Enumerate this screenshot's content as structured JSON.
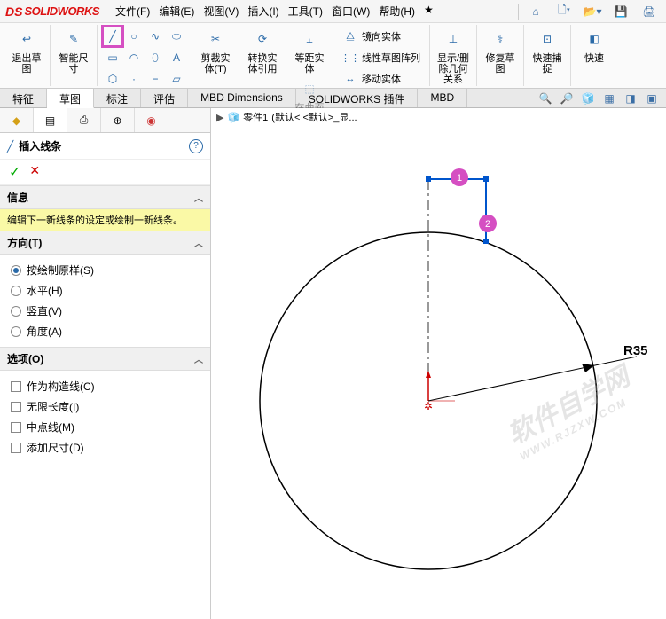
{
  "app": {
    "logo_ds": "DS",
    "logo_text": "SOLIDWORKS"
  },
  "menu": {
    "file": "文件(F)",
    "edit": "编辑(E)",
    "view": "视图(V)",
    "insert": "插入(I)",
    "tools": "工具(T)",
    "window": "窗口(W)",
    "help": "帮助(H)",
    "star": "★"
  },
  "ribbon": {
    "exit_sketch": "退出草图",
    "smart_dim": "智能尺寸",
    "trim": "剪裁实体(T)",
    "convert": "转换实体引用",
    "offset": "等距实体",
    "on_surface": "在曲面上偏移",
    "mirror": "镜向实体",
    "linear_pattern": "线性草图阵列",
    "move": "移动实体",
    "display_rel": "显示/删除几何关系",
    "repair": "修复草图",
    "quick_snap": "快速捕捉",
    "quick_sk": "快速"
  },
  "tabs": {
    "features": "特征",
    "sketch": "草图",
    "annotate": "标注",
    "evaluate": "评估",
    "mbd_dim": "MBD Dimensions",
    "sw_addins": "SOLIDWORKS 插件",
    "mbd": "MBD"
  },
  "breadcrumb": {
    "part": "零件1",
    "state": "(默认< <默认>_显..."
  },
  "pm": {
    "title": "插入线条",
    "info_head": "信息",
    "info_text": "编辑下一新线条的设定或绘制一新线条。",
    "direction_head": "方向(T)",
    "as_sketched": "按绘制原样(S)",
    "horizontal": "水平(H)",
    "vertical": "竖直(V)",
    "angle": "角度(A)",
    "options_head": "选项(O)",
    "construction": "作为构造线(C)",
    "infinite": "无限长度(I)",
    "midpoint": "中点线(M)",
    "add_dim": "添加尺寸(D)"
  },
  "sketch": {
    "radius_label": "R35",
    "badge1": "1",
    "badge2": "2"
  },
  "watermark": {
    "main": "软件自学网",
    "sub": "WWW.RJZXW.COM"
  }
}
